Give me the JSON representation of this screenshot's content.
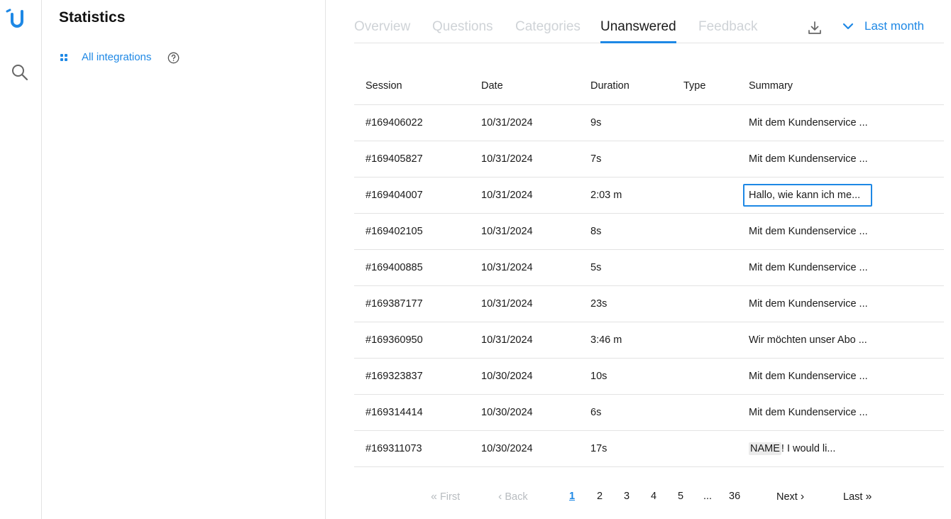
{
  "app": {
    "logo_icon": "brand-u-icon",
    "search_icon": "search-icon",
    "accent_color": "#1e88e5"
  },
  "panel": {
    "title": "Statistics",
    "integrations_label": "All integrations",
    "help_icon": "help-circle-icon"
  },
  "tabs": [
    {
      "label": "Overview",
      "active": false
    },
    {
      "label": "Questions",
      "active": false
    },
    {
      "label": "Categories",
      "active": false
    },
    {
      "label": "Unanswered",
      "active": true
    },
    {
      "label": "Feedback",
      "active": false
    }
  ],
  "toolbar": {
    "download_icon": "download-icon",
    "period_label": "Last month"
  },
  "table": {
    "columns": [
      "Session",
      "Date",
      "Duration",
      "Type",
      "Summary"
    ],
    "rows": [
      {
        "session": "#169406022",
        "date": "10/31/2024",
        "duration": "9s",
        "type": "",
        "summary": "Mit dem Kundenservice ..."
      },
      {
        "session": "#169405827",
        "date": "10/31/2024",
        "duration": "7s",
        "type": "",
        "summary": "Mit dem Kundenservice ..."
      },
      {
        "session": "#169404007",
        "date": "10/31/2024",
        "duration": "2:03 m",
        "type": "",
        "summary": "Hallo, wie kann ich me..."
      },
      {
        "session": "#169402105",
        "date": "10/31/2024",
        "duration": "8s",
        "type": "",
        "summary": "Mit dem Kundenservice ..."
      },
      {
        "session": "#169400885",
        "date": "10/31/2024",
        "duration": "5s",
        "type": "",
        "summary": "Mit dem Kundenservice ..."
      },
      {
        "session": "#169387177",
        "date": "10/31/2024",
        "duration": "23s",
        "type": "",
        "summary": "Mit dem Kundenservice ..."
      },
      {
        "session": "#169360950",
        "date": "10/31/2024",
        "duration": "3:46 m",
        "type": "",
        "summary": "Wir möchten unser Abo ..."
      },
      {
        "session": "#169323837",
        "date": "10/30/2024",
        "duration": "10s",
        "type": "",
        "summary": "Mit dem Kundenservice ..."
      },
      {
        "session": "#169314414",
        "date": "10/30/2024",
        "duration": "6s",
        "type": "",
        "summary": "Mit dem Kundenservice ..."
      },
      {
        "session": "#169311073",
        "date": "10/30/2024",
        "duration": "17s",
        "type": "",
        "summary_tag": "NAME",
        "summary": "! I would li..."
      }
    ]
  },
  "pagination": {
    "first": "First",
    "back": "Back",
    "pages": [
      "1",
      "2",
      "3",
      "4",
      "5",
      "...",
      "36"
    ],
    "current": "1",
    "next": "Next",
    "last": "Last"
  }
}
